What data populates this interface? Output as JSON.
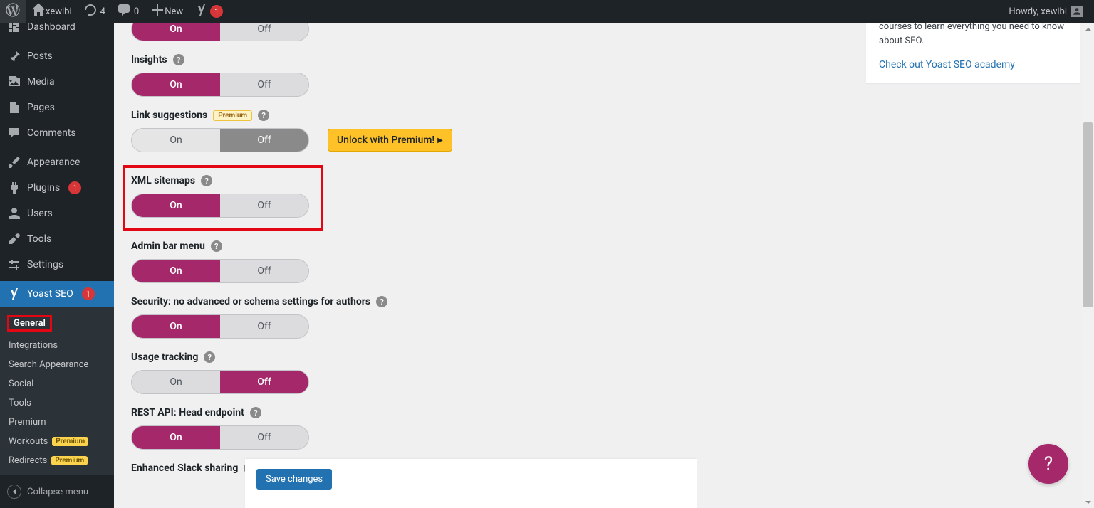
{
  "adminbar": {
    "site_name": "xewibi",
    "updates_count": "4",
    "comments_count": "0",
    "new_label": "New",
    "yoast_count": "1",
    "howdy": "Howdy, xewibi"
  },
  "sidebar": {
    "dashboard": "Dashboard",
    "posts": "Posts",
    "media": "Media",
    "pages": "Pages",
    "comments": "Comments",
    "appearance": "Appearance",
    "plugins": "Plugins",
    "plugins_badge": "1",
    "users": "Users",
    "tools": "Tools",
    "settings": "Settings",
    "yoast": "Yoast SEO",
    "yoast_badge": "1",
    "sub": {
      "general": "General",
      "integrations": "Integrations",
      "search_appearance": "Search Appearance",
      "social": "Social",
      "tools": "Tools",
      "premium": "Premium",
      "workouts": "Workouts",
      "redirects": "Redirects",
      "premium_pill": "Premium"
    },
    "collapse": "Collapse menu"
  },
  "settings": {
    "on": "On",
    "off": "Off",
    "insights": "Insights",
    "link_suggestions": "Link suggestions",
    "premium_badge": "Premium",
    "unlock": "Unlock with Premium!",
    "xml_sitemaps": "XML sitemaps",
    "admin_bar": "Admin bar menu",
    "security": "Security: no advanced or schema settings for authors",
    "usage_tracking": "Usage tracking",
    "rest_api": "REST API: Head endpoint",
    "slack": "Enhanced Slack sharing",
    "save": "Save changes"
  },
  "sidecard": {
    "text": "courses to learn everything you need to know about SEO.",
    "link": "Check out Yoast SEO academy"
  },
  "help": "?"
}
